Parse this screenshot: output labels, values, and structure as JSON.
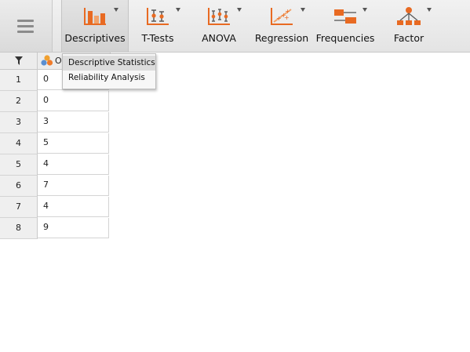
{
  "ribbon": {
    "buttons": [
      {
        "label": "Descriptives",
        "icon": "descriptives-icon"
      },
      {
        "label": "T-Tests",
        "icon": "t-tests-icon"
      },
      {
        "label": "ANOVA",
        "icon": "anova-icon"
      },
      {
        "label": "Regression",
        "icon": "regression-icon"
      },
      {
        "label": "Frequencies",
        "icon": "frequencies-icon"
      },
      {
        "label": "Factor",
        "icon": "factor-icon"
      }
    ],
    "active": "Descriptives"
  },
  "dropdown": {
    "items": [
      {
        "label": "Descriptive Statistics",
        "state": "highlighted"
      },
      {
        "label": "Reliability Analysis"
      }
    ]
  },
  "grid": {
    "column_header": "O",
    "rows": [
      {
        "num": "1",
        "value": "0"
      },
      {
        "num": "2",
        "value": "0"
      },
      {
        "num": "3",
        "value": "3"
      },
      {
        "num": "4",
        "value": "5"
      },
      {
        "num": "5",
        "value": "4"
      },
      {
        "num": "6",
        "value": "7"
      },
      {
        "num": "7",
        "value": "4"
      },
      {
        "num": "8",
        "value": "9"
      }
    ]
  },
  "colors": {
    "accent_orange": "#e86a22",
    "accent_dark": "#5a5a5a",
    "icon_light": "#f2a36a"
  }
}
